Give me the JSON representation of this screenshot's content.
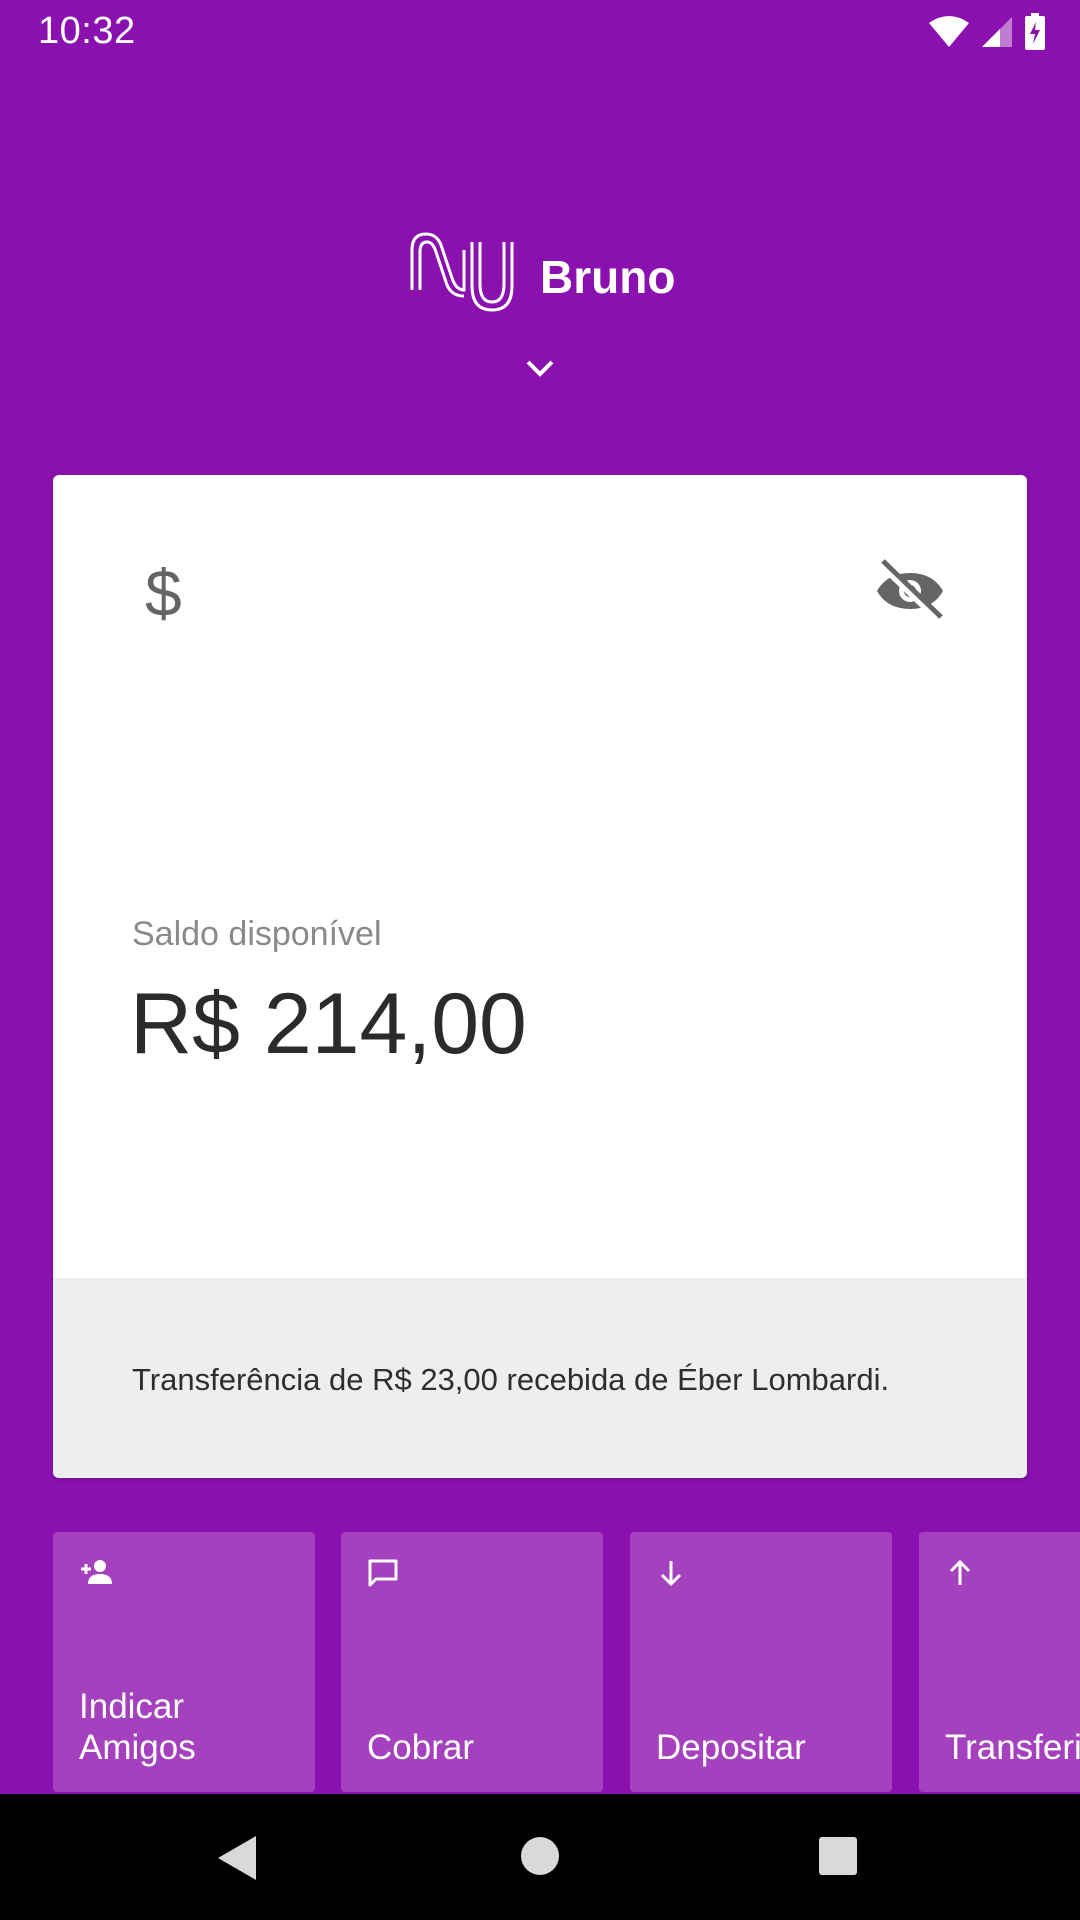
{
  "status_bar": {
    "time": "10:32",
    "icons": [
      "wifi-icon",
      "cell-signal-icon",
      "battery-charging-icon"
    ]
  },
  "header": {
    "logo_icon": "nubank-logo",
    "name": "Bruno",
    "expand_icon": "chevron-down-icon"
  },
  "account_card": {
    "currency_icon": "dollar-icon",
    "visibility_icon": "eye-off-icon",
    "balance_label": "Saldo disponível",
    "balance_value": "R$ 214,00",
    "notification": "Transferência de R$ 23,00 recebida de Éber Lombardi."
  },
  "shortcuts": [
    {
      "icon": "person-add-icon",
      "label": "Indicar\nAmigos"
    },
    {
      "icon": "chat-icon",
      "label": "Cobrar"
    },
    {
      "icon": "arrow-down-icon",
      "label": "Depositar"
    },
    {
      "icon": "arrow-up-icon",
      "label": "Transferir"
    }
  ],
  "colors": {
    "background": "#8a11af",
    "shortcut_tile": "#a541bf",
    "card": "#ffffff",
    "card_footer": "#eeeeee"
  },
  "nav_bar": {
    "icons": [
      "back-icon",
      "home-icon",
      "recents-icon"
    ]
  }
}
